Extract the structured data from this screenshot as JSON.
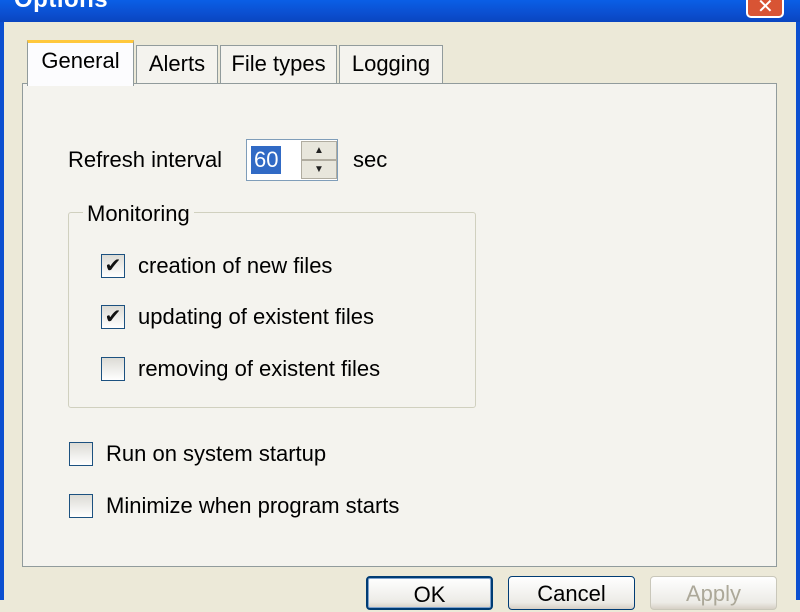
{
  "window": {
    "title": "Options"
  },
  "tabs": [
    {
      "label": "General",
      "active": true
    },
    {
      "label": "Alerts",
      "active": false
    },
    {
      "label": "File types",
      "active": false
    },
    {
      "label": "Logging",
      "active": false
    }
  ],
  "general": {
    "refresh_label": "Refresh interval",
    "refresh_value": "60",
    "refresh_unit": "sec",
    "monitoring": {
      "legend": "Monitoring",
      "items": [
        {
          "label": "creation of new files",
          "checked": true
        },
        {
          "label": "updating of existent files",
          "checked": true
        },
        {
          "label": "removing of existent files",
          "checked": false
        }
      ]
    },
    "options": [
      {
        "label": "Run on system startup",
        "checked": false
      },
      {
        "label": "Minimize when program starts",
        "checked": false
      }
    ]
  },
  "buttons": {
    "ok": "OK",
    "cancel": "Cancel",
    "apply": "Apply"
  },
  "icons": {
    "check": "✔",
    "close": "✕",
    "spin_up": "▲",
    "spin_down": "▼"
  }
}
